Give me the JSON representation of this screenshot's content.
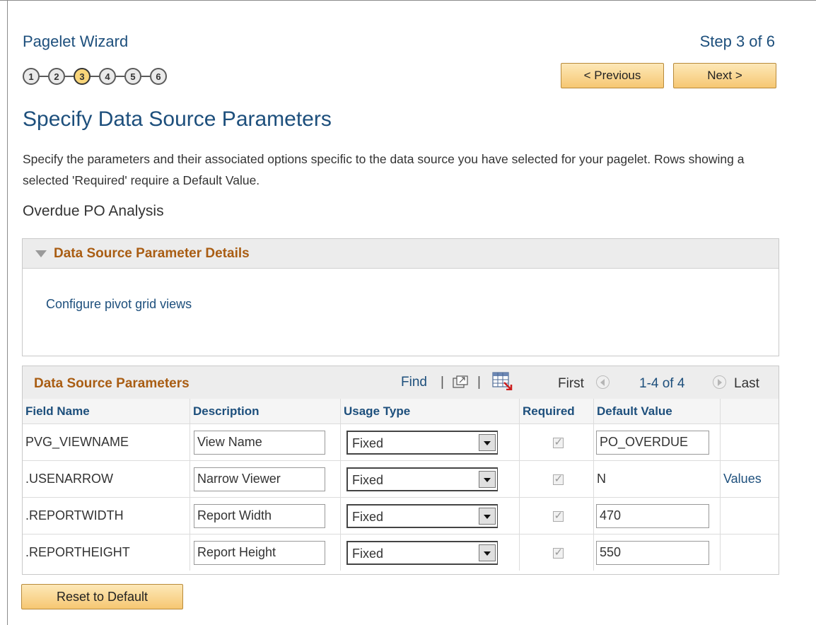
{
  "wizard": {
    "title": "Pagelet Wizard",
    "step_label": "Step 3 of 6",
    "steps": [
      "1",
      "2",
      "3",
      "4",
      "5",
      "6"
    ],
    "active_step": 3,
    "previous_label": "< Previous",
    "next_label": "Next >"
  },
  "page": {
    "heading": "Specify Data Source Parameters",
    "instructions": "Specify the parameters and their associated options specific to the data source you have selected for your pagelet.  Rows showing a selected 'Required' require a Default Value.",
    "source_name": "Overdue PO Analysis"
  },
  "details_section": {
    "title": "Data Source Parameter Details",
    "link_label": "Configure pivot grid views"
  },
  "grid": {
    "title": "Data Source Parameters",
    "find_label": "Find",
    "separator": "|",
    "nav_first": "First",
    "nav_range": "1-4 of 4",
    "nav_last": "Last",
    "columns": [
      "Field Name",
      "Description",
      "Usage Type",
      "Required",
      "Default Value"
    ],
    "rows": [
      {
        "field": "PVG_VIEWNAME",
        "description": "View Name",
        "usage": "Fixed",
        "required": true,
        "default": "PO_OVERDUE",
        "default_editable": true,
        "values_link": ""
      },
      {
        "field": ".USENARROW",
        "description": "Narrow Viewer",
        "usage": "Fixed",
        "required": true,
        "default": "N",
        "default_editable": false,
        "values_link": "Values"
      },
      {
        "field": ".REPORTWIDTH",
        "description": "Report Width",
        "usage": "Fixed",
        "required": true,
        "default": "470",
        "default_editable": true,
        "values_link": ""
      },
      {
        "field": ".REPORTHEIGHT",
        "description": "Report Height",
        "usage": "Fixed",
        "required": true,
        "default": "550",
        "default_editable": true,
        "values_link": ""
      }
    ]
  },
  "footer": {
    "reset_label": "Reset to Default"
  },
  "colors": {
    "heading_blue": "#1d4f7c",
    "section_orange": "#a95d13",
    "button_gradient_top": "#fde8b8",
    "button_gradient_bottom": "#f6c772",
    "active_step": "#f8d57a"
  }
}
